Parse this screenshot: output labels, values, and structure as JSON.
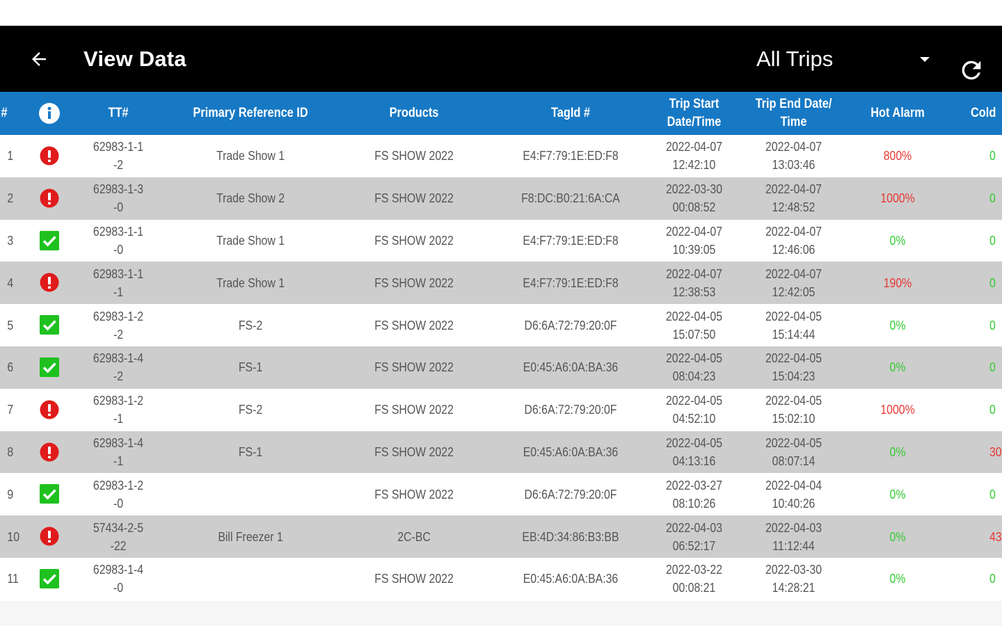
{
  "toolbar": {
    "title": "View Data",
    "trip_filter": "All Trips",
    "back_icon": "arrow-left-icon",
    "refresh_icon": "refresh-icon",
    "dropdown_icon": "caret-down-icon"
  },
  "columns": {
    "num": "#",
    "info_icon": "info-icon",
    "tt": "TT#",
    "ref": "Primary Reference ID",
    "products": "Products",
    "tag": "TagId #",
    "start_l1": "Trip Start",
    "start_l2": "Date/Time",
    "end_l1": "Trip End Date/",
    "end_l2": "Time",
    "hot": "Hot Alarm",
    "cold": "Cold"
  },
  "colors": {
    "header_bg": "#1778c4",
    "alarm_red": "#e53935",
    "ok_green": "#33cc33",
    "row_alt": "#cdcdcd"
  },
  "rows": [
    {
      "num": "1",
      "status": "alarm",
      "tt_l1": "62983-1-1",
      "tt_l2": "-2",
      "ref": "Trade Show 1",
      "products": "FS SHOW 2022",
      "tag": "E4:F7:79:1E:ED:F8",
      "start_date": "2022-04-07",
      "start_time": "12:42:10",
      "end_date": "2022-04-07",
      "end_time": "13:03:46",
      "hot": "800%",
      "hot_level": "red",
      "cold": "0",
      "cold_level": "green"
    },
    {
      "num": "2",
      "status": "alarm",
      "tt_l1": "62983-1-3",
      "tt_l2": "-0",
      "ref": "Trade Show 2",
      "products": "FS SHOW 2022",
      "tag": "F8:DC:B0:21:6A:CA",
      "start_date": "2022-03-30",
      "start_time": "00:08:52",
      "end_date": "2022-04-07",
      "end_time": "12:48:52",
      "hot": "1000%",
      "hot_level": "red",
      "cold": "0",
      "cold_level": "green"
    },
    {
      "num": "3",
      "status": "ok",
      "tt_l1": "62983-1-1",
      "tt_l2": "-0",
      "ref": "Trade Show 1",
      "products": "FS SHOW 2022",
      "tag": "E4:F7:79:1E:ED:F8",
      "start_date": "2022-04-07",
      "start_time": "10:39:05",
      "end_date": "2022-04-07",
      "end_time": "12:46:06",
      "hot": "0%",
      "hot_level": "green",
      "cold": "0",
      "cold_level": "green"
    },
    {
      "num": "4",
      "status": "alarm",
      "tt_l1": "62983-1-1",
      "tt_l2": "-1",
      "ref": "Trade Show 1",
      "products": "FS SHOW 2022",
      "tag": "E4:F7:79:1E:ED:F8",
      "start_date": "2022-04-07",
      "start_time": "12:38:53",
      "end_date": "2022-04-07",
      "end_time": "12:42:05",
      "hot": "190%",
      "hot_level": "red",
      "cold": "0",
      "cold_level": "green"
    },
    {
      "num": "5",
      "status": "ok",
      "tt_l1": "62983-1-2",
      "tt_l2": "-2",
      "ref": "FS-2",
      "products": "FS SHOW 2022",
      "tag": "D6:6A:72:79:20:0F",
      "start_date": "2022-04-05",
      "start_time": "15:07:50",
      "end_date": "2022-04-05",
      "end_time": "15:14:44",
      "hot": "0%",
      "hot_level": "green",
      "cold": "0",
      "cold_level": "green"
    },
    {
      "num": "6",
      "status": "ok",
      "tt_l1": "62983-1-4",
      "tt_l2": "-2",
      "ref": "FS-1",
      "products": "FS SHOW 2022",
      "tag": "E0:45:A6:0A:BA:36",
      "start_date": "2022-04-05",
      "start_time": "08:04:23",
      "end_date": "2022-04-05",
      "end_time": "15:04:23",
      "hot": "0%",
      "hot_level": "green",
      "cold": "0",
      "cold_level": "green"
    },
    {
      "num": "7",
      "status": "alarm",
      "tt_l1": "62983-1-2",
      "tt_l2": "-1",
      "ref": "FS-2",
      "products": "FS SHOW 2022",
      "tag": "D6:6A:72:79:20:0F",
      "start_date": "2022-04-05",
      "start_time": "04:52:10",
      "end_date": "2022-04-05",
      "end_time": "15:02:10",
      "hot": "1000%",
      "hot_level": "red",
      "cold": "0",
      "cold_level": "green"
    },
    {
      "num": "8",
      "status": "alarm",
      "tt_l1": "62983-1-4",
      "tt_l2": "-1",
      "ref": "FS-1",
      "products": "FS SHOW 2022",
      "tag": "E0:45:A6:0A:BA:36",
      "start_date": "2022-04-05",
      "start_time": "04:13:16",
      "end_date": "2022-04-05",
      "end_time": "08:07:14",
      "hot": "0%",
      "hot_level": "green",
      "cold": "30",
      "cold_level": "red"
    },
    {
      "num": "9",
      "status": "ok",
      "tt_l1": "62983-1-2",
      "tt_l2": "-0",
      "ref": "",
      "products": "FS SHOW 2022",
      "tag": "D6:6A:72:79:20:0F",
      "start_date": "2022-03-27",
      "start_time": "08:10:26",
      "end_date": "2022-04-04",
      "end_time": "10:40:26",
      "hot": "0%",
      "hot_level": "green",
      "cold": "0",
      "cold_level": "green"
    },
    {
      "num": "10",
      "status": "alarm",
      "tt_l1": "57434-2-5",
      "tt_l2": "-22",
      "ref": "Bill Freezer 1",
      "products": "2C-BC",
      "tag": "EB:4D:34:86:B3:BB",
      "start_date": "2022-04-03",
      "start_time": "06:52:17",
      "end_date": "2022-04-03",
      "end_time": "11:12:44",
      "hot": "0%",
      "hot_level": "green",
      "cold": "43",
      "cold_level": "red"
    },
    {
      "num": "11",
      "status": "ok",
      "tt_l1": "62983-1-4",
      "tt_l2": "-0",
      "ref": "",
      "products": "FS SHOW 2022",
      "tag": "E0:45:A6:0A:BA:36",
      "start_date": "2022-03-22",
      "start_time": "00:08:21",
      "end_date": "2022-03-30",
      "end_time": "14:28:21",
      "hot": "0%",
      "hot_level": "green",
      "cold": "0",
      "cold_level": "green"
    }
  ]
}
